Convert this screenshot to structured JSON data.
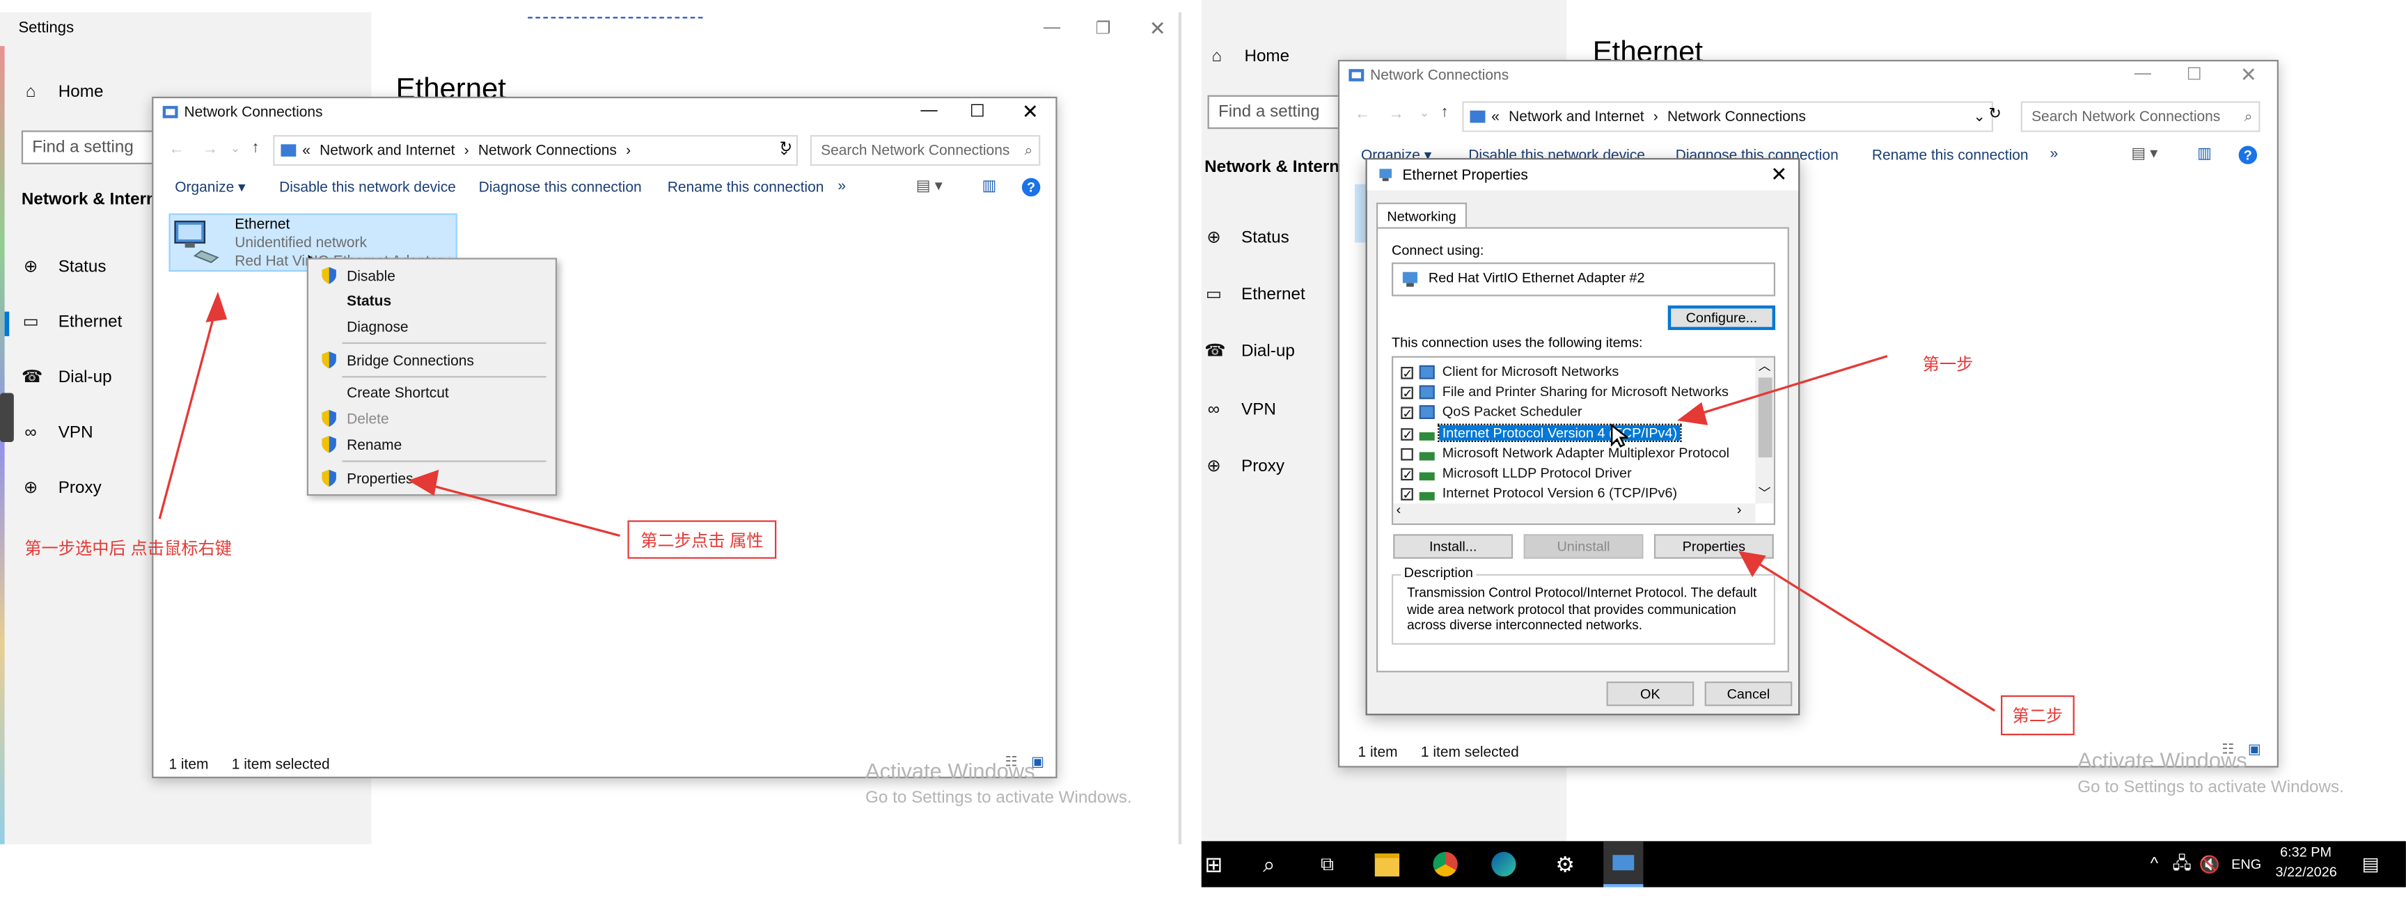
{
  "left": {
    "settings": {
      "title": "Settings",
      "home": "Home",
      "search_placeholder": "Find a setting",
      "section": "Network & Interne",
      "nav": [
        {
          "label": "Status",
          "icon": "globe-status-icon"
        },
        {
          "label": "Ethernet",
          "icon": "ethernet-icon"
        },
        {
          "label": "Dial-up",
          "icon": "dialup-icon"
        },
        {
          "label": "VPN",
          "icon": "vpn-icon"
        },
        {
          "label": "Proxy",
          "icon": "globe-icon"
        }
      ],
      "header": "Ethernet"
    },
    "explorer": {
      "title": "Network Connections",
      "breadcrumb": [
        "Network and Internet",
        "Network Connections"
      ],
      "breadcrumb_prefix": "«",
      "search_placeholder": "Search Network Connections",
      "commands": [
        "Organize ▾",
        "Disable this network device",
        "Diagnose this connection",
        "Rename this connection",
        "»"
      ],
      "item": {
        "name": "Ethernet",
        "status": "Unidentified network",
        "adapter": "Red Hat VirtIO Ethernet Adapter #2"
      },
      "status_count": "1 item",
      "status_selected": "1 item selected"
    },
    "context_menu": [
      {
        "label": "Disable",
        "shield": true
      },
      {
        "label": "Status",
        "bold": true
      },
      {
        "label": "Diagnose"
      },
      {
        "label": "Bridge Connections",
        "shield": true
      },
      {
        "label": "Create Shortcut"
      },
      {
        "label": "Delete",
        "shield": true,
        "disabled": true
      },
      {
        "label": "Rename",
        "shield": true
      },
      {
        "label": "Properties",
        "shield": true
      }
    ],
    "annotations": {
      "step1": "第一步选中后 点击鼠标右键",
      "step2": "第二步点击 属性"
    },
    "watermark": {
      "line1": "Activate Windows",
      "line2": "Go to Settings to activate Windows."
    }
  },
  "right": {
    "settings": {
      "home": "Home",
      "search_placeholder": "Find a setting",
      "section": "Network & Interne",
      "nav": [
        {
          "label": "Status",
          "icon": "globe-status-icon"
        },
        {
          "label": "Ethernet",
          "icon": "ethernet-icon"
        },
        {
          "label": "Dial-up",
          "icon": "dialup-icon"
        },
        {
          "label": "VPN",
          "icon": "vpn-icon"
        },
        {
          "label": "Proxy",
          "icon": "globe-icon"
        }
      ],
      "header": "Ethernet"
    },
    "explorer": {
      "title": "Network Connections",
      "breadcrumb": [
        "Network and Internet",
        "Network Connections"
      ],
      "breadcrumb_prefix": "«",
      "search_placeholder": "Search Network Connections",
      "commands": [
        "Organize ▾",
        "Disable this network device",
        "Diagnose this connection",
        "Rename this connection",
        "»"
      ],
      "status_count": "1 item",
      "status_selected": "1 item selected"
    },
    "dialog": {
      "title": "Ethernet Properties",
      "tab": "Networking",
      "connect_using_label": "Connect using:",
      "adapter": "Red Hat VirtIO Ethernet Adapter #2",
      "configure": "Configure...",
      "items_label": "This connection uses the following items:",
      "items": [
        {
          "label": "Client for Microsoft Networks",
          "checked": true,
          "icon": "network-client-icon"
        },
        {
          "label": "File and Printer Sharing for Microsoft Networks",
          "checked": true,
          "icon": "network-client-icon"
        },
        {
          "label": "QoS Packet Scheduler",
          "checked": true,
          "icon": "network-client-icon"
        },
        {
          "label": "Internet Protocol Version 4 (TCP/IPv4)",
          "checked": true,
          "selected": true,
          "icon": "protocol-icon"
        },
        {
          "label": "Microsoft Network Adapter Multiplexor Protocol",
          "checked": false,
          "icon": "protocol-icon"
        },
        {
          "label": "Microsoft LLDP Protocol Driver",
          "checked": true,
          "icon": "protocol-icon"
        },
        {
          "label": "Internet Protocol Version 6 (TCP/IPv6)",
          "checked": true,
          "icon": "protocol-icon"
        }
      ],
      "install": "Install...",
      "uninstall": "Uninstall",
      "properties": "Properties",
      "description_label": "Description",
      "description": "Transmission Control Protocol/Internet Protocol. The default wide area network protocol that provides communication across diverse interconnected networks.",
      "ok": "OK",
      "cancel": "Cancel"
    },
    "annotations": {
      "step1": "第一步",
      "step2": "第二步"
    },
    "watermark": {
      "line1": "Activate Windows",
      "line2": "Go to Settings to activate Windows."
    },
    "taskbar": {
      "lang": "ENG",
      "time": "6:32 PM",
      "date": "3/22/2026"
    }
  },
  "colors": {
    "accent": "#0078d7",
    "annotation": "#e53935",
    "selection": "#cce8ff"
  }
}
